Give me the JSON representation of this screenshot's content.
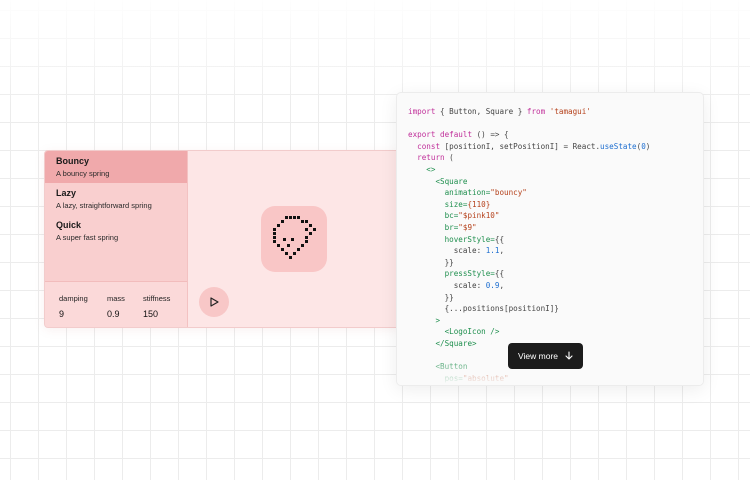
{
  "animation_options": [
    {
      "title": "Bouncy",
      "description": "A bouncy spring",
      "active": true
    },
    {
      "title": "Lazy",
      "description": "A lazy, straightforward spring",
      "active": false
    },
    {
      "title": "Quick",
      "description": "A super fast spring",
      "active": false
    }
  ],
  "params": [
    {
      "label": "damping",
      "value": "9"
    },
    {
      "label": "mass",
      "value": "0.9"
    },
    {
      "label": "stiffness",
      "value": "150"
    }
  ],
  "preview": {
    "logo_icon": "tamagui-logo-icon",
    "play_icon": "play-icon"
  },
  "code": {
    "lines": [
      [
        {
          "t": "import",
          "c": "kw"
        },
        {
          "t": " { Button, Square } "
        },
        {
          "t": "from",
          "c": "kw"
        },
        {
          "t": " "
        },
        {
          "t": "'tamagui'",
          "c": "str"
        }
      ],
      [],
      [
        {
          "t": "export",
          "c": "kw"
        },
        {
          "t": " "
        },
        {
          "t": "default",
          "c": "kw"
        },
        {
          "t": " () => {"
        }
      ],
      [
        {
          "t": "  "
        },
        {
          "t": "const",
          "c": "kw"
        },
        {
          "t": " [positionI, setPositionI] = React."
        },
        {
          "t": "useState",
          "c": "fn"
        },
        {
          "t": "("
        },
        {
          "t": "0",
          "c": "num"
        },
        {
          "t": ")"
        }
      ],
      [
        {
          "t": "  "
        },
        {
          "t": "return",
          "c": "kw"
        },
        {
          "t": " ("
        }
      ],
      [
        {
          "t": "    "
        },
        {
          "t": "<>",
          "c": "tag"
        }
      ],
      [
        {
          "t": "      "
        },
        {
          "t": "<Square",
          "c": "tag"
        }
      ],
      [
        {
          "t": "        "
        },
        {
          "t": "animation=",
          "c": "tag"
        },
        {
          "t": "\"bouncy\"",
          "c": "attr"
        }
      ],
      [
        {
          "t": "        "
        },
        {
          "t": "size=",
          "c": "tag"
        },
        {
          "t": "{110}",
          "c": "attr"
        }
      ],
      [
        {
          "t": "        "
        },
        {
          "t": "bc=",
          "c": "tag"
        },
        {
          "t": "\"$pink10\"",
          "c": "attr"
        }
      ],
      [
        {
          "t": "        "
        },
        {
          "t": "br=",
          "c": "tag"
        },
        {
          "t": "\"$9\"",
          "c": "attr"
        }
      ],
      [
        {
          "t": "        "
        },
        {
          "t": "hoverStyle=",
          "c": "tag"
        },
        {
          "t": "{{"
        }
      ],
      [
        {
          "t": "          scale: "
        },
        {
          "t": "1.1",
          "c": "num"
        },
        {
          "t": ","
        }
      ],
      [
        {
          "t": "        }}"
        }
      ],
      [
        {
          "t": "        "
        },
        {
          "t": "pressStyle=",
          "c": "tag"
        },
        {
          "t": "{{"
        }
      ],
      [
        {
          "t": "          scale: "
        },
        {
          "t": "0.9",
          "c": "num"
        },
        {
          "t": ","
        }
      ],
      [
        {
          "t": "        }}"
        }
      ],
      [
        {
          "t": "        {...positions[positionI]}"
        }
      ],
      [
        {
          "t": "      "
        },
        {
          "t": ">",
          "c": "tag"
        }
      ],
      [
        {
          "t": "        "
        },
        {
          "t": "<LogoIcon />",
          "c": "tag"
        }
      ],
      [
        {
          "t": "      "
        },
        {
          "t": "</Square>",
          "c": "tag"
        }
      ],
      [],
      [
        {
          "t": "      "
        },
        {
          "t": "<Button",
          "c": "tag"
        }
      ],
      [
        {
          "t": "        "
        },
        {
          "t": "pos=",
          "c": "tag"
        },
        {
          "t": "\"absolute\"",
          "c": "attr"
        }
      ]
    ]
  },
  "view_more": {
    "label": "View more",
    "icon": "arrow-down-icon"
  }
}
